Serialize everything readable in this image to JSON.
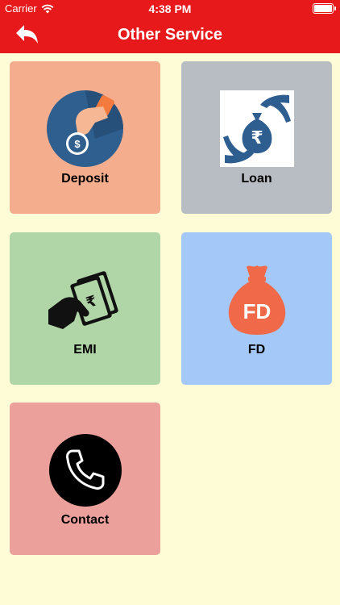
{
  "status": {
    "carrier": "Carrier",
    "time": "4:38 PM"
  },
  "nav": {
    "title": "Other Service",
    "back_icon": "back-arrow-icon"
  },
  "tiles": [
    {
      "label": "Deposit",
      "color": "#f4ae8e",
      "icon": "deposit-coin-hand-icon"
    },
    {
      "label": "Loan",
      "color": "#b8bdc4",
      "icon": "loan-rupee-bag-icon"
    },
    {
      "label": "EMI",
      "color": "#b0d6a8",
      "icon": "emi-cash-hand-icon"
    },
    {
      "label": "FD",
      "color": "#a4c8f7",
      "icon": "fd-money-bag-icon"
    },
    {
      "label": "Contact",
      "color": "#eca09c",
      "icon": "phone-icon"
    }
  ],
  "colors": {
    "header": "#e8191b",
    "background": "#fdfcd6"
  }
}
